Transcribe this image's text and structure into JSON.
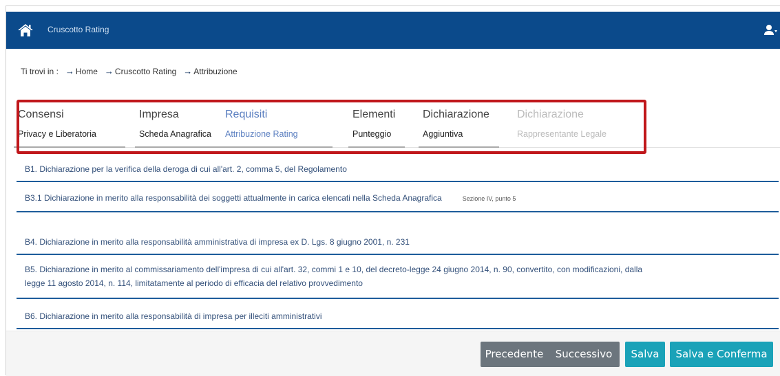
{
  "header": {
    "title": "Cruscotto Rating"
  },
  "breadcrumb": {
    "label": "Ti trovi in :",
    "items": [
      "Home",
      "Cruscotto Rating",
      "Attribuzione"
    ]
  },
  "tabs": [
    {
      "title": "Consensi",
      "subtitle": "Privacy e Liberatoria",
      "state": "normal"
    },
    {
      "title": "Impresa",
      "subtitle": "Scheda Anagrafica",
      "state": "normal"
    },
    {
      "title": "Requisiti",
      "subtitle": "Attribuzione Rating",
      "state": "active"
    },
    {
      "title": "Elementi",
      "subtitle": "Punteggio",
      "state": "normal"
    },
    {
      "title": "Dichiarazione",
      "subtitle": "Aggiuntiva",
      "state": "normal"
    },
    {
      "title": "Dichiarazione",
      "subtitle": "Rappresentante Legale",
      "state": "disabled"
    }
  ],
  "declarations": [
    {
      "text": "B1. Dichiarazione per la verifica della deroga di cui all'art. 2, comma 5, del Regolamento"
    },
    {
      "text": "B3.1 Dichiarazione in merito alla responsabilità dei soggetti attualmente in carica elencati nella Scheda Anagrafica",
      "note": "Sezione IV, punto 5"
    },
    {
      "text": "B4. Dichiarazione in merito alla responsabilità amministrativa di impresa ex D. Lgs. 8 giugno 2001, n. 231"
    },
    {
      "text": "B5. Dichiarazione in merito al commissariamento dell'impresa di cui all'art. 32, commi 1 e 10, del decreto-legge 24 giugno 2014, n. 90, convertito, con modificazioni, dalla",
      "text2": "legge 11 agosto 2014, n. 114, limitatamente al periodo di efficacia del relativo provvedimento"
    },
    {
      "text": "B6. Dichiarazione in merito alla responsabilità di impresa per illeciti amministrativi"
    }
  ],
  "buttons": {
    "previous": "Precedente",
    "next": "Successivo",
    "save": "Salva",
    "save_confirm": "Salva e Conferma"
  },
  "colors": {
    "navbar": "#0b4a8b",
    "highlight": "#c0171b",
    "teal": "#1aa2b8",
    "gray": "#6c757d"
  },
  "icons": {
    "home": "home-icon",
    "user": "user-icon",
    "breadcrumb_arrow": "arrow-right-icon"
  }
}
